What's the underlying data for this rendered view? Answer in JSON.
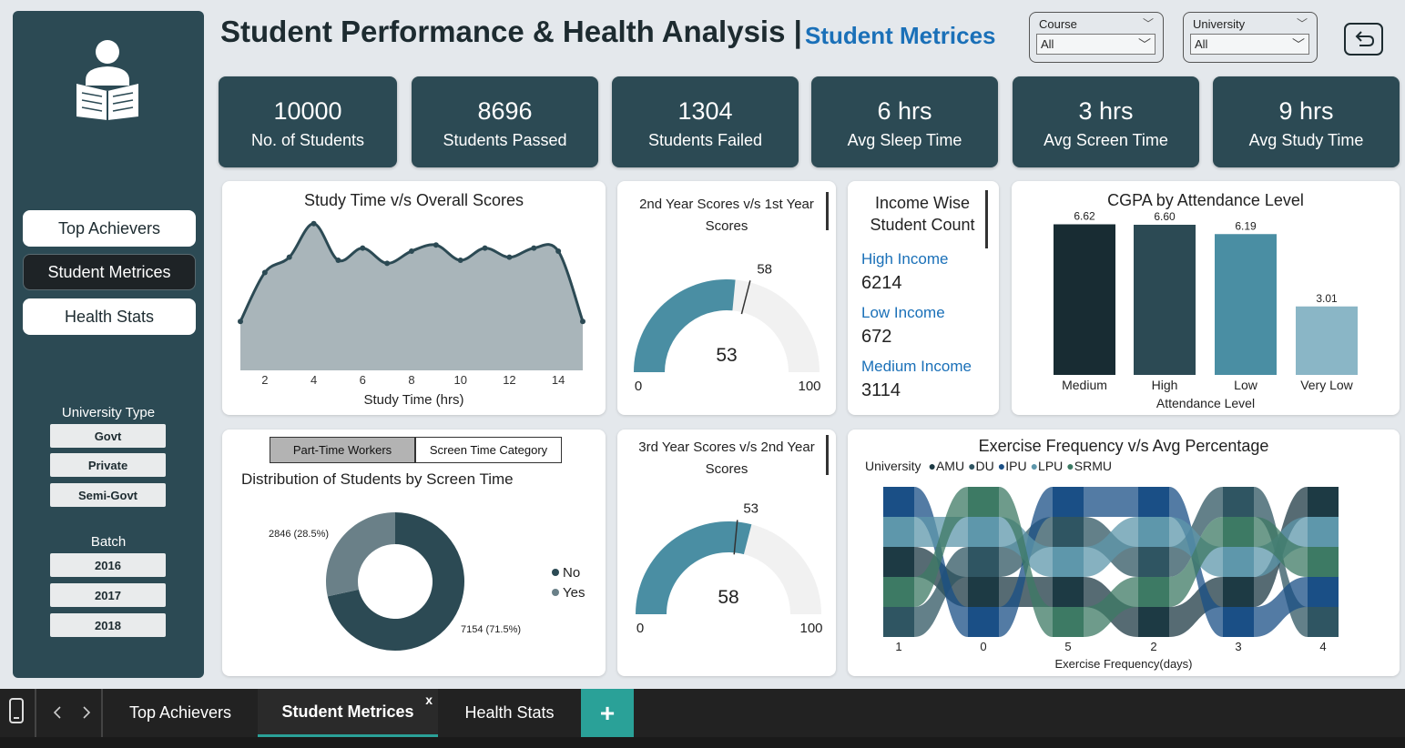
{
  "header": {
    "title": "Student Performance & Health Analysis",
    "separator": "|",
    "subtitle": "Student Metrices"
  },
  "filters": {
    "course": {
      "label": "Course",
      "value": "All"
    },
    "university": {
      "label": "University",
      "value": "All"
    }
  },
  "sidebar": {
    "nav": [
      "Top Achievers",
      "Student Metrices",
      "Health Stats"
    ],
    "active_nav": "Student Metrices",
    "university_type": {
      "title": "University Type",
      "items": [
        "Govt",
        "Private",
        "Semi-Govt"
      ]
    },
    "batch": {
      "title": "Batch",
      "items": [
        "2016",
        "2017",
        "2018"
      ]
    }
  },
  "kpis": [
    {
      "value": "10000",
      "label": "No. of Students"
    },
    {
      "value": "8696",
      "label": "Students Passed"
    },
    {
      "value": "1304",
      "label": "Students Failed"
    },
    {
      "value": "6 hrs",
      "label": "Avg Sleep Time"
    },
    {
      "value": "3 hrs",
      "label": "Avg Screen Time"
    },
    {
      "value": "9 hrs",
      "label": "Avg Study Time"
    }
  ],
  "income": {
    "title_line1": "Income Wise",
    "title_line2": "Student Count",
    "items": [
      {
        "label": "High Income",
        "value": "6214"
      },
      {
        "label": "Low Income",
        "value": "672"
      },
      {
        "label": "Medium Income",
        "value": "3114"
      }
    ]
  },
  "donut_panel": {
    "buttons": [
      "Part-Time Workers",
      "Screen Time Category"
    ]
  },
  "gauges": {
    "g1": {
      "title_line1": "2nd Year Scores v/s 1st Year",
      "title_line2": "Scores",
      "value": 53,
      "target": 58,
      "min": "0",
      "max": "100",
      "value_label": "53",
      "target_label": "58"
    },
    "g2": {
      "title_line1": "3rd Year Scores v/s 2nd Year",
      "title_line2": "Scores",
      "value": 58,
      "target": 53,
      "min": "0",
      "max": "100",
      "value_label": "58",
      "target_label": "53"
    }
  },
  "tabs": {
    "items": [
      "Top Achievers",
      "Student Metrices",
      "Health Stats"
    ],
    "active": "Student Metrices",
    "close_glyph": "x",
    "add_glyph": "+"
  },
  "colors": {
    "dark": "#2c4a54",
    "darkest": "#182c33",
    "teal": "#4a8ea3",
    "light_teal": "#8ab6c6",
    "area": "#a9b5ba",
    "accent_blue": "#1a70b8",
    "tab_green": "#2aa198"
  },
  "chart_data": [
    {
      "id": "study-time-line",
      "type": "area",
      "title": "Study Time v/s Overall Scores",
      "xlabel": "Study Time (hrs)",
      "ylabel": "",
      "x": [
        1,
        2,
        3,
        4,
        5,
        6,
        7,
        8,
        9,
        10,
        11,
        12,
        13,
        14,
        15
      ],
      "values": [
        46,
        62,
        67,
        78,
        66,
        70,
        65,
        69,
        71,
        66,
        70,
        67,
        70,
        69,
        46
      ],
      "xticks": [
        "2",
        "4",
        "6",
        "8",
        "10",
        "12",
        "14"
      ],
      "xlim": [
        1,
        15
      ],
      "ylim": [
        30,
        80
      ]
    },
    {
      "id": "cgpa-bar",
      "type": "bar",
      "title": "CGPA by Attendance Level",
      "xlabel": "Attendance Level",
      "categories": [
        "Medium",
        "High",
        "Low",
        "Very Low"
      ],
      "values": [
        6.62,
        6.6,
        6.19,
        3.01
      ],
      "value_labels": [
        "6.62",
        "6.60",
        "6.19",
        "3.01"
      ],
      "colors": [
        "#182c33",
        "#2c4a54",
        "#4a8ea3",
        "#8ab6c6"
      ],
      "ylim": [
        0,
        7
      ]
    },
    {
      "id": "screen-time-donut",
      "type": "pie",
      "title": "Distribution of Students by Screen Time",
      "categories": [
        "No",
        "Yes"
      ],
      "values": [
        7154,
        2846
      ],
      "value_labels": [
        "7154 (71.5%)",
        "2846 (28.5%)"
      ],
      "colors": [
        "#2c4a54",
        "#6a8088"
      ]
    },
    {
      "id": "exercise-ribbon",
      "type": "bar",
      "title": "Exercise Frequency v/s Avg Percentage",
      "legend_title": "University",
      "legend": [
        "AMU",
        "DU",
        "IPU",
        "LPU",
        "SRMU"
      ],
      "legend_colors": [
        "#1d3a44",
        "#2f5562",
        "#1a4f86",
        "#5e97ab",
        "#3d7a64"
      ],
      "xlabel": "Exercise Frequency(days)",
      "categories": [
        "1",
        "0",
        "5",
        "2",
        "3",
        "4"
      ],
      "order": [
        [
          "IPU",
          "LPU",
          "AMU",
          "SRMU",
          "DU"
        ],
        [
          "SRMU",
          "LPU",
          "DU",
          "AMU",
          "IPU"
        ],
        [
          "IPU",
          "DU",
          "LPU",
          "AMU",
          "SRMU"
        ],
        [
          "IPU",
          "LPU",
          "DU",
          "SRMU",
          "AMU"
        ],
        [
          "DU",
          "SRMU",
          "LPU",
          "AMU",
          "IPU"
        ],
        [
          "AMU",
          "LPU",
          "SRMU",
          "IPU",
          "DU"
        ]
      ]
    }
  ]
}
